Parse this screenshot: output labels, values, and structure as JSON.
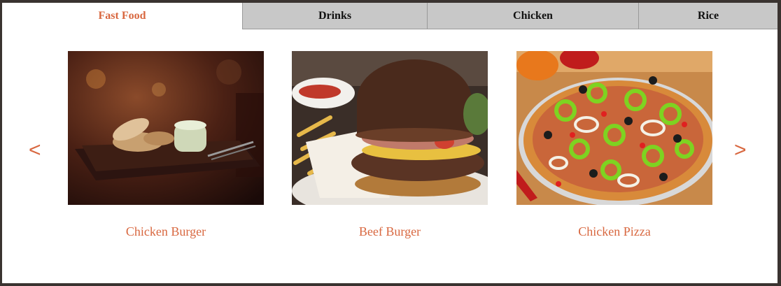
{
  "tabs": [
    {
      "label": "Fast Food",
      "active": true
    },
    {
      "label": "Drinks",
      "active": false
    },
    {
      "label": "Chicken",
      "active": false
    },
    {
      "label": "Rice",
      "active": false
    }
  ],
  "carousel": {
    "prev_label": "<",
    "next_label": ">",
    "items": [
      {
        "title": "Chicken Burger",
        "image": "bread-and-dip-plate-photo"
      },
      {
        "title": "Beef Burger",
        "image": "burger-with-fries-photo"
      },
      {
        "title": "Chicken Pizza",
        "image": "pepper-pizza-photo"
      }
    ]
  },
  "colors": {
    "accent": "#d8673f",
    "tab_inactive_bg": "#c8c8c8",
    "frame_bg": "#ffffff",
    "outer_bg": "#3a3330"
  }
}
